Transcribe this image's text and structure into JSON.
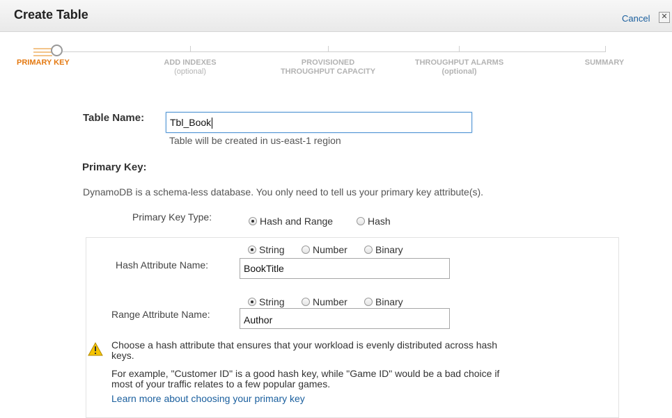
{
  "window": {
    "title": "Create Table",
    "cancel_label": "Cancel",
    "close_glyph": "✕"
  },
  "wizard": {
    "steps": [
      {
        "label": "PRIMARY KEY",
        "sub": ""
      },
      {
        "label": "ADD INDEXES",
        "sub": "(optional)"
      },
      {
        "label": "PROVISIONED",
        "sub": "THROUGHPUT CAPACITY"
      },
      {
        "label": "THROUGHPUT ALARMS",
        "sub": "(optional)"
      },
      {
        "label": "SUMMARY",
        "sub": ""
      }
    ],
    "active_step": 0
  },
  "table_name": {
    "label": "Table Name:",
    "value": "Tbl_Book",
    "hint": "Table will be created in us-east-1 region"
  },
  "primary_key": {
    "heading": "Primary Key:",
    "description": "DynamoDB is a schema-less database. You only need to tell us your primary key attribute(s).",
    "type_label": "Primary Key Type:",
    "type_options": [
      "Hash and Range",
      "Hash"
    ],
    "type_selected": "Hash and Range"
  },
  "hash_attribute": {
    "label": "Hash Attribute Name:",
    "value": "BookTitle",
    "type_options": [
      "String",
      "Number",
      "Binary"
    ],
    "type_selected": "String"
  },
  "range_attribute": {
    "label": "Range Attribute Name:",
    "value": "Author",
    "type_options": [
      "String",
      "Number",
      "Binary"
    ],
    "type_selected": "String"
  },
  "advice": {
    "icon": "warning-icon",
    "line1": "Choose a hash attribute that ensures that your workload is evenly distributed across hash",
    "line2": "keys.",
    "line3": "For example, \"Customer ID\" is a good hash key, while \"Game ID\" would be a bad choice if",
    "line4": "most of your traffic relates to a few popular games.",
    "link": "Learn more about choosing your primary key"
  },
  "colors": {
    "accent": "#e47911",
    "link": "#1a5f9e",
    "warning": "#f5c400"
  }
}
